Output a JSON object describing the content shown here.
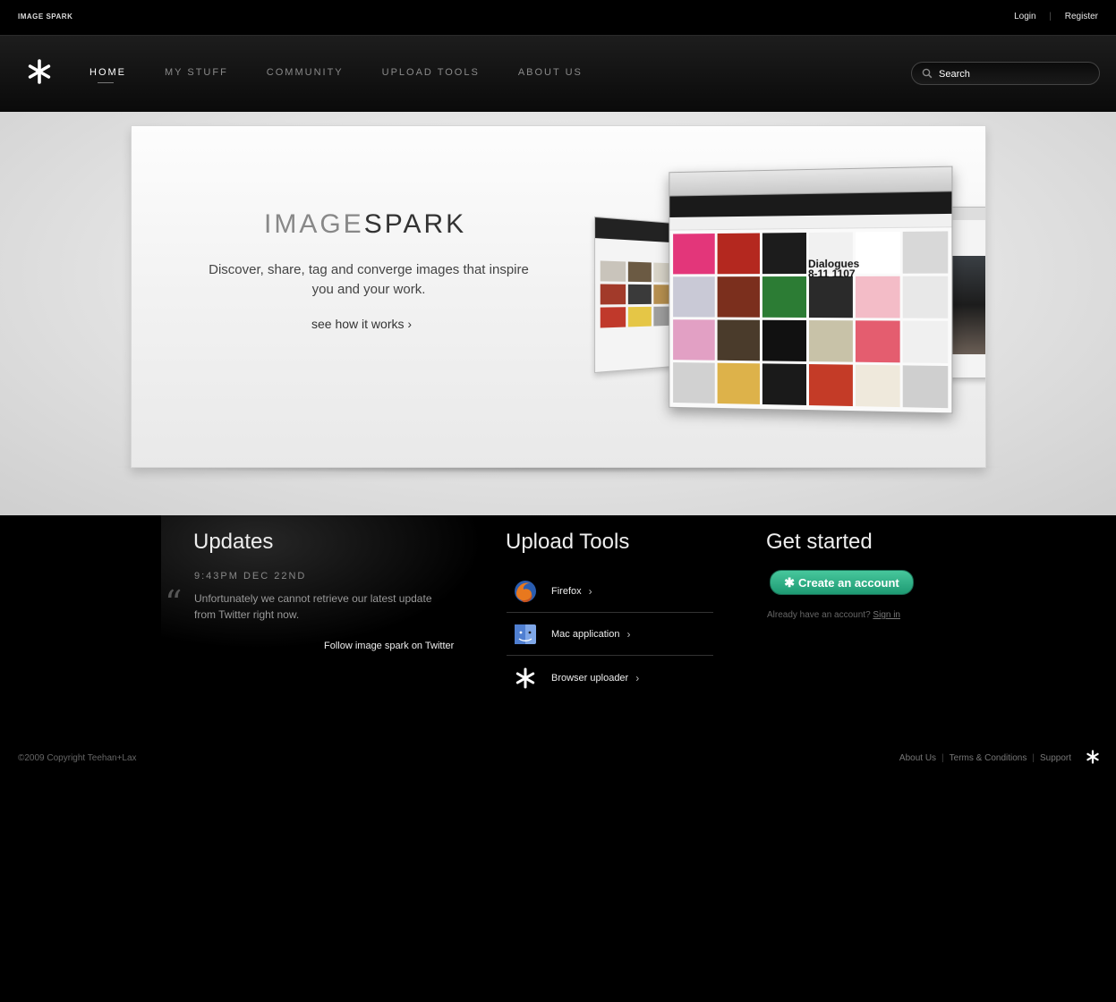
{
  "topbar": {
    "brand": "IMAGE SPARK",
    "login": "Login",
    "register": "Register"
  },
  "nav": {
    "items": [
      {
        "label": "HOME",
        "active": true
      },
      {
        "label": "MY STUFF",
        "active": false
      },
      {
        "label": "COMMUNITY",
        "active": false
      },
      {
        "label": "UPLOAD TOOLS",
        "active": false
      },
      {
        "label": "ABOUT US",
        "active": false
      }
    ]
  },
  "search": {
    "placeholder": "Search"
  },
  "hero": {
    "title_light": "IMAGE",
    "title_dark": "SPARK",
    "description": "Discover, share, tag and converge images that inspire you and your work.",
    "link": "see how it works",
    "mock_text": "Dialogues 8-11 1107"
  },
  "updates": {
    "title": "Updates",
    "timestamp": "9:43PM DEC 22ND",
    "message": "Unfortunately we cannot retrieve our latest update from Twitter right now.",
    "follow": "Follow image spark on Twitter"
  },
  "upload_tools": {
    "title": "Upload Tools",
    "items": [
      {
        "label": "Firefox",
        "icon": "firefox-icon"
      },
      {
        "label": "Mac application",
        "icon": "mac-finder-icon"
      },
      {
        "label": "Browser uploader",
        "icon": "star-icon"
      }
    ]
  },
  "get_started": {
    "title": "Get started",
    "button": "Create an account",
    "already": "Already have an account?",
    "sign_in": "Sign in"
  },
  "footer": {
    "copyright": "©2009 Copyright Teehan+Lax",
    "links": [
      "About Us",
      "Terms & Conditions",
      "Support"
    ]
  },
  "colors": {
    "accent_green": "#2fb386",
    "background": "#000000"
  }
}
